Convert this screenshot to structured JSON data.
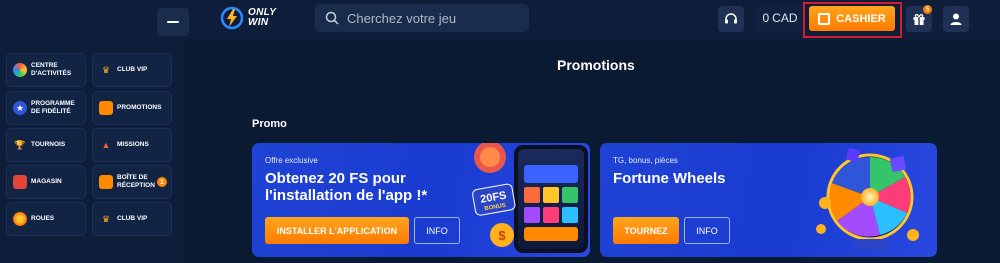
{
  "header": {
    "logo_line1": "ONLY",
    "logo_line2": "WIN",
    "search_placeholder": "Cherchez votre jeu",
    "balance_amount": "0",
    "balance_currency": "CAD",
    "cashier_label": "CASHIER",
    "gift_count": "5"
  },
  "sidebar": {
    "items": [
      {
        "label": "Centre d'activités",
        "icon": "activity-wheel-icon"
      },
      {
        "label": "Club VIP",
        "icon": "crown-icon"
      },
      {
        "label": "Programme de fidélité",
        "icon": "loyalty-icon"
      },
      {
        "label": "Promotions",
        "icon": "gift-box-icon"
      },
      {
        "label": "Tournois",
        "icon": "trophy-icon"
      },
      {
        "label": "Missions",
        "icon": "rocket-icon"
      },
      {
        "label": "Magasin",
        "icon": "shop-icon"
      },
      {
        "label": "Boîte de réception",
        "icon": "inbox-icon",
        "badge": "1"
      },
      {
        "label": "Roues",
        "icon": "wheel-icon"
      },
      {
        "label": "Club VIP",
        "icon": "crown-icon"
      }
    ]
  },
  "main": {
    "page_title": "Promotions",
    "section_title": "Promo",
    "cards": [
      {
        "eyebrow": "Offre exclusive",
        "headline": "Obtenez 20 FS pour l'installation de l'app !*",
        "primary_label": "INSTALLER L'APPLICATION",
        "info_label": "INFO",
        "badge_text": "20FS",
        "badge_sub": "BONUS"
      },
      {
        "eyebrow": "TG, bonus, pièces",
        "headline": "Fortune Wheels",
        "primary_label": "TOURNEZ",
        "info_label": "INFO"
      }
    ]
  },
  "colors": {
    "background": "#0b1a33",
    "accent_orange": "#ff7a00",
    "card_blue": "#1f43d4",
    "highlight_red": "#d31d2e"
  }
}
